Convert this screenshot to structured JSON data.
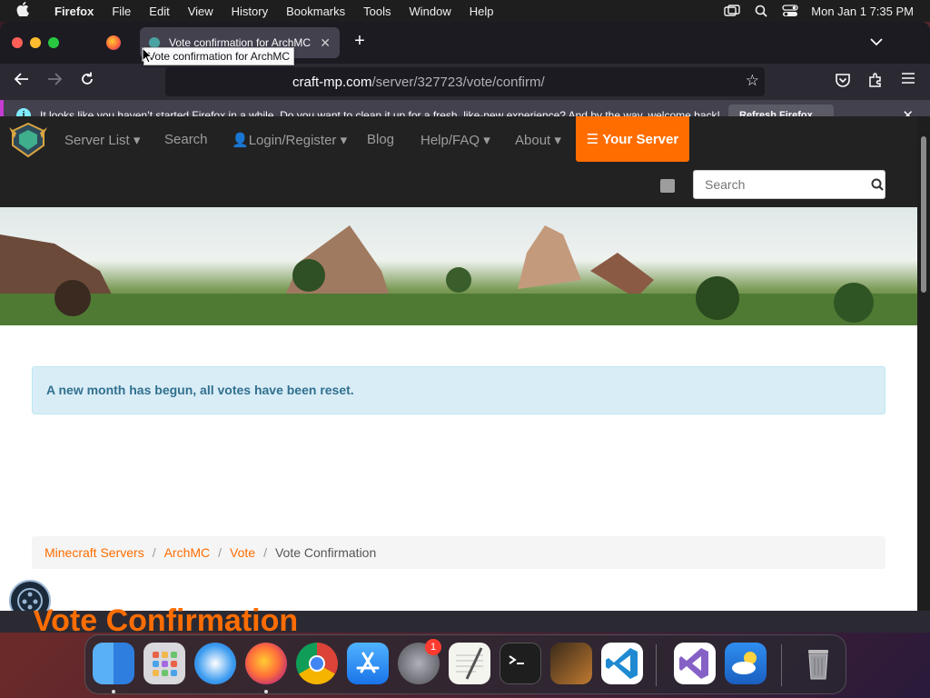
{
  "menubar": {
    "app_name": "Firefox",
    "items": [
      "File",
      "Edit",
      "View",
      "History",
      "Bookmarks",
      "Tools",
      "Window",
      "Help"
    ],
    "clock": "Mon Jan 1  7:35 PM"
  },
  "browser": {
    "tab_title": "Vote confirmation for ArchMC",
    "tooltip": "Vote confirmation for ArchMC",
    "url_host": "craft-mp.com",
    "url_path": "/server/327723/vote/confirm/",
    "notice_text": "It looks like you haven’t started Firefox in a while. Do you want to clean it up for a fresh, like-new experience? And by the way, welcome back!",
    "notice_button": "Refresh Firefox…"
  },
  "site": {
    "nav": {
      "server_list": "Server List",
      "search": "Search",
      "login": "Login/Register",
      "blog": "Blog",
      "help": "Help/FAQ",
      "about": "About",
      "your_server": "Your Server"
    },
    "search_placeholder": "Search",
    "alert": "A new month has begun, all votes have been reset.",
    "breadcrumb": {
      "crumb1": "Minecraft Servers",
      "crumb2": "ArchMC",
      "crumb3": "Vote",
      "active": "Vote Confirmation"
    },
    "heading": "Vote Confirmation"
  },
  "dock": {
    "badge_count": "1",
    "apps": [
      "finder-icon",
      "launchpad-icon",
      "safari-icon",
      "firefox-icon",
      "chrome-icon",
      "app-store-icon",
      "system-settings-icon",
      "textedit-icon",
      "terminal-icon",
      "garageband-icon",
      "vscode-icon",
      "visual-studio-icon",
      "weather-icon",
      "trash-icon"
    ]
  }
}
